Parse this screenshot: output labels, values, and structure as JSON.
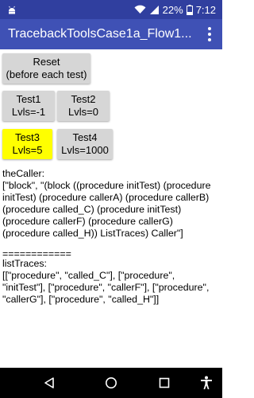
{
  "status_bar": {
    "battery_percent": "22%",
    "time": "7:12",
    "icons": [
      "android-notification-icon",
      "wifi-icon",
      "signal-icon",
      "battery-icon"
    ]
  },
  "app_bar": {
    "title": "TracebackToolsCase1a_Flow1...",
    "menu_icon": "overflow-menu-icon"
  },
  "buttons": {
    "reset": [
      "Reset",
      "(before each test)"
    ],
    "test1": [
      "Test1",
      "Lvls=-1"
    ],
    "test2": [
      "Test2",
      "Lvls=0"
    ],
    "test3": [
      "Test3",
      "Lvls=5"
    ],
    "test4": [
      "Test4",
      "Lvls=1000"
    ]
  },
  "colors": {
    "status_bar": "#303f9f",
    "app_bar": "#3f51b5",
    "button_default": "#d6d6d6",
    "button_highlight": "#ffff00"
  },
  "output": {
    "caller_label": "theCaller:",
    "caller_value": "[\"block\", \"(block ((procedure initTest) (procedure initTest) (procedure callerA) (procedure callerB) (procedure called_C) (procedure initTest) (procedure callerF) (procedure callerG) (procedure called_H)) ListTraces) Caller\"]",
    "separator": "============",
    "traces_label": "listTraces:",
    "traces_value": "[[\"procedure\", \"called_C\"], [\"procedure\", \"initTest\"], [\"procedure\", \"callerF\"], [\"procedure\", \"callerG\"], [\"procedure\", \"called_H\"]]"
  },
  "nav_bar": {
    "icons": [
      "back-icon",
      "home-icon",
      "recents-icon",
      "accessibility-icon"
    ]
  }
}
